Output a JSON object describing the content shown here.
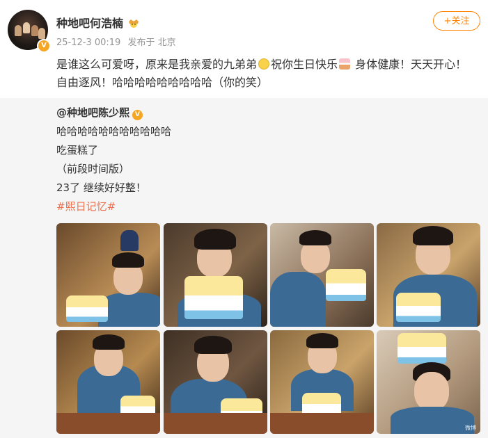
{
  "author": {
    "name": "种地吧何浩楠",
    "crown_icon": "crown-emoji-icon",
    "verified_icon": "verified-v-icon",
    "verified_symbol": "V"
  },
  "meta": {
    "timestamp": "25-12-3 00:19",
    "location": "发布于 北京"
  },
  "follow": {
    "label": "+关注"
  },
  "post": {
    "text_1": "是谁这么可爱呀，原来是我亲爱的九弟弟",
    "text_2": "祝你生日快乐",
    "text_3": " 身体健康！天天开心！自由逐风！哈哈哈哈哈哈哈哈哈（你的笑）"
  },
  "repost": {
    "author": "@种地吧陈少熙",
    "verified_symbol": "V",
    "lines": [
      "哈哈哈哈哈哈哈哈哈哈哈",
      "吃蛋糕了",
      "（前段时间版）",
      "23了 继续好好整！"
    ],
    "hashtag": "#熙日记忆#"
  },
  "photos": {
    "watermark": "微博"
  },
  "colors": {
    "accent": "#ff8200",
    "hashtag": "#eb7350",
    "repost_bg": "#f5f5f5",
    "verified": "#f5a623"
  }
}
